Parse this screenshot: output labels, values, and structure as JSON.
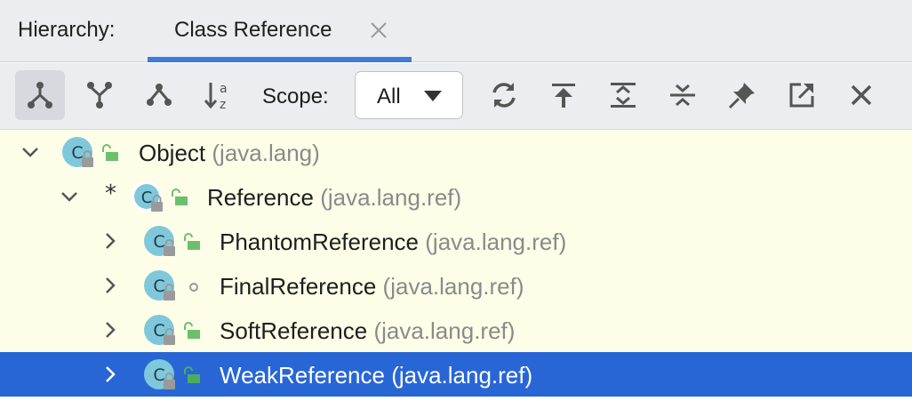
{
  "header": {
    "hierarchy_label": "Hierarchy:",
    "tab": {
      "label": "Class Reference"
    }
  },
  "toolbar": {
    "buttons": [
      "subtypes-hierarchy-icon",
      "supertypes-hierarchy-icon",
      "class-hierarchy-icon",
      "sort-alphabetically-icon"
    ],
    "scope_label": "Scope:",
    "scope_value": "All",
    "actions": [
      "refresh-icon",
      "scroll-to-source-icon",
      "expand-all-icon",
      "collapse-all-icon",
      "pin-tab-icon",
      "export-icon",
      "close-icon"
    ]
  },
  "tree": {
    "rows": [
      {
        "name": "Object",
        "package": "(java.lang)",
        "chevron": "expanded"
      },
      {
        "prefix": "*",
        "name": "Reference",
        "package": "(java.lang.ref)",
        "chevron": "expanded"
      },
      {
        "name": "PhantomReference",
        "package": "(java.lang.ref)",
        "chevron": "collapsed"
      },
      {
        "name": "FinalReference",
        "package": "(java.lang.ref)",
        "chevron": "collapsed",
        "visibility": "package-private"
      },
      {
        "name": "SoftReference",
        "package": "(java.lang.ref)",
        "chevron": "collapsed"
      },
      {
        "name": "WeakReference",
        "package": "(java.lang.ref)",
        "chevron": "collapsed",
        "selected": true
      }
    ]
  },
  "colors": {
    "tree_background": "#fefee8",
    "selection": "#2866d6",
    "class_icon": "#7fc8dc",
    "public_lock": "#6cc06c",
    "tab_underline": "#3c7bd9"
  }
}
